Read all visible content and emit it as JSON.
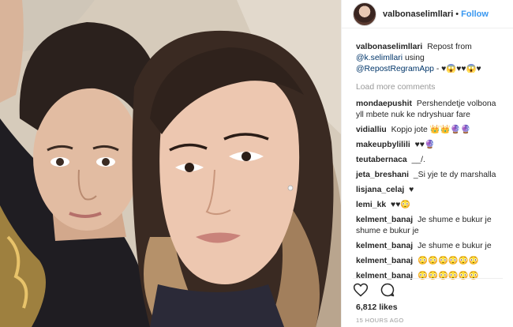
{
  "header": {
    "username": "valbonaselimllari",
    "separator": "•",
    "follow_label": "Follow"
  },
  "caption": {
    "username": "valbonaselimllari",
    "text_1": "Repost from",
    "mention_1": "@k.selimllari",
    "text_2": "using",
    "mention_2": "@RepostRegramApp",
    "text_3": "- ♥😱♥♥😱♥"
  },
  "load_more_label": "Load more comments",
  "comments": [
    {
      "user": "mondaepushit",
      "text": "Pershendetje volbona yll mbete nuk ke ndryshuar fare"
    },
    {
      "user": "vidialliu",
      "text": "Kopjo jote 👑👑🔮🔮"
    },
    {
      "user": "makeupbylilili",
      "text": "♥♥🔮"
    },
    {
      "user": "teutabernaca",
      "text": "__/."
    },
    {
      "user": "jeta_breshani",
      "text": "_Si yje te dy marshalla"
    },
    {
      "user": "lisjana_celaj",
      "text": "♥"
    },
    {
      "user": "lemi_kk",
      "text": "♥♥😳"
    },
    {
      "user": "kelment_banaj",
      "text": "Je shume e bukur je shume e bukur je"
    },
    {
      "user": "kelment_banaj",
      "text": "Je shume e bukur je"
    },
    {
      "user": "kelment_banaj",
      "text": "😳😳😳😳😳😳"
    },
    {
      "user": "kelment_banaj",
      "text": "😳😳😳😳😳😳"
    }
  ],
  "likes": "6,812 likes",
  "timestamp": "15 HOURS AGO",
  "icons": [
    "heart-icon",
    "comment-icon"
  ],
  "colors": {
    "follow": "#3897f0",
    "mention": "#003569",
    "muted": "#999999"
  }
}
